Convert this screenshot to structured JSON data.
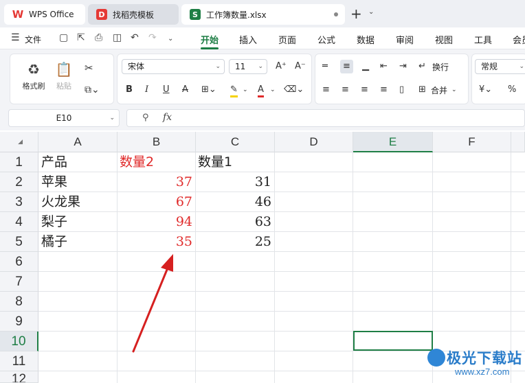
{
  "tabs": [
    {
      "label": "WPS Office",
      "icon": "wps-logo-icon"
    },
    {
      "label": "找稻壳模板",
      "icon": "docer-icon"
    },
    {
      "label": "工作簿数量.xlsx",
      "icon": "spreadsheet-icon"
    }
  ],
  "menu": {
    "file_label": "文件",
    "ribbon_tabs": [
      "开始",
      "插入",
      "页面",
      "公式",
      "数据",
      "审阅",
      "视图",
      "工具",
      "会员"
    ]
  },
  "ribbon": {
    "format_painter": "格式刷",
    "paste": "粘贴",
    "font_name": "宋体",
    "font_size": "11",
    "wrap": "换行",
    "merge": "合并",
    "number_format": "常规"
  },
  "formula_bar": {
    "name_box": "E10",
    "fx": "fx"
  },
  "sheet": {
    "columns": [
      "A",
      "B",
      "C",
      "D",
      "E",
      "F"
    ],
    "rows": [
      "1",
      "2",
      "3",
      "4",
      "5",
      "6",
      "7",
      "8",
      "9",
      "10",
      "11",
      "12"
    ],
    "active_col": "E",
    "active_row": "10",
    "cells": {
      "A1": "产品",
      "B1": "数量2",
      "C1": "数量1",
      "A2": "苹果",
      "B2": "37",
      "C2": "31",
      "A3": "火龙果",
      "B3": "67",
      "C3": "46",
      "A4": "梨子",
      "B4": "94",
      "C4": "63",
      "A5": "橘子",
      "B5": "35",
      "C5": "25"
    },
    "red_color": "#e02a2a",
    "accent_color": "#1e7e45"
  },
  "watermark": {
    "text": "极光下载站",
    "url": "www.xz7.com"
  }
}
